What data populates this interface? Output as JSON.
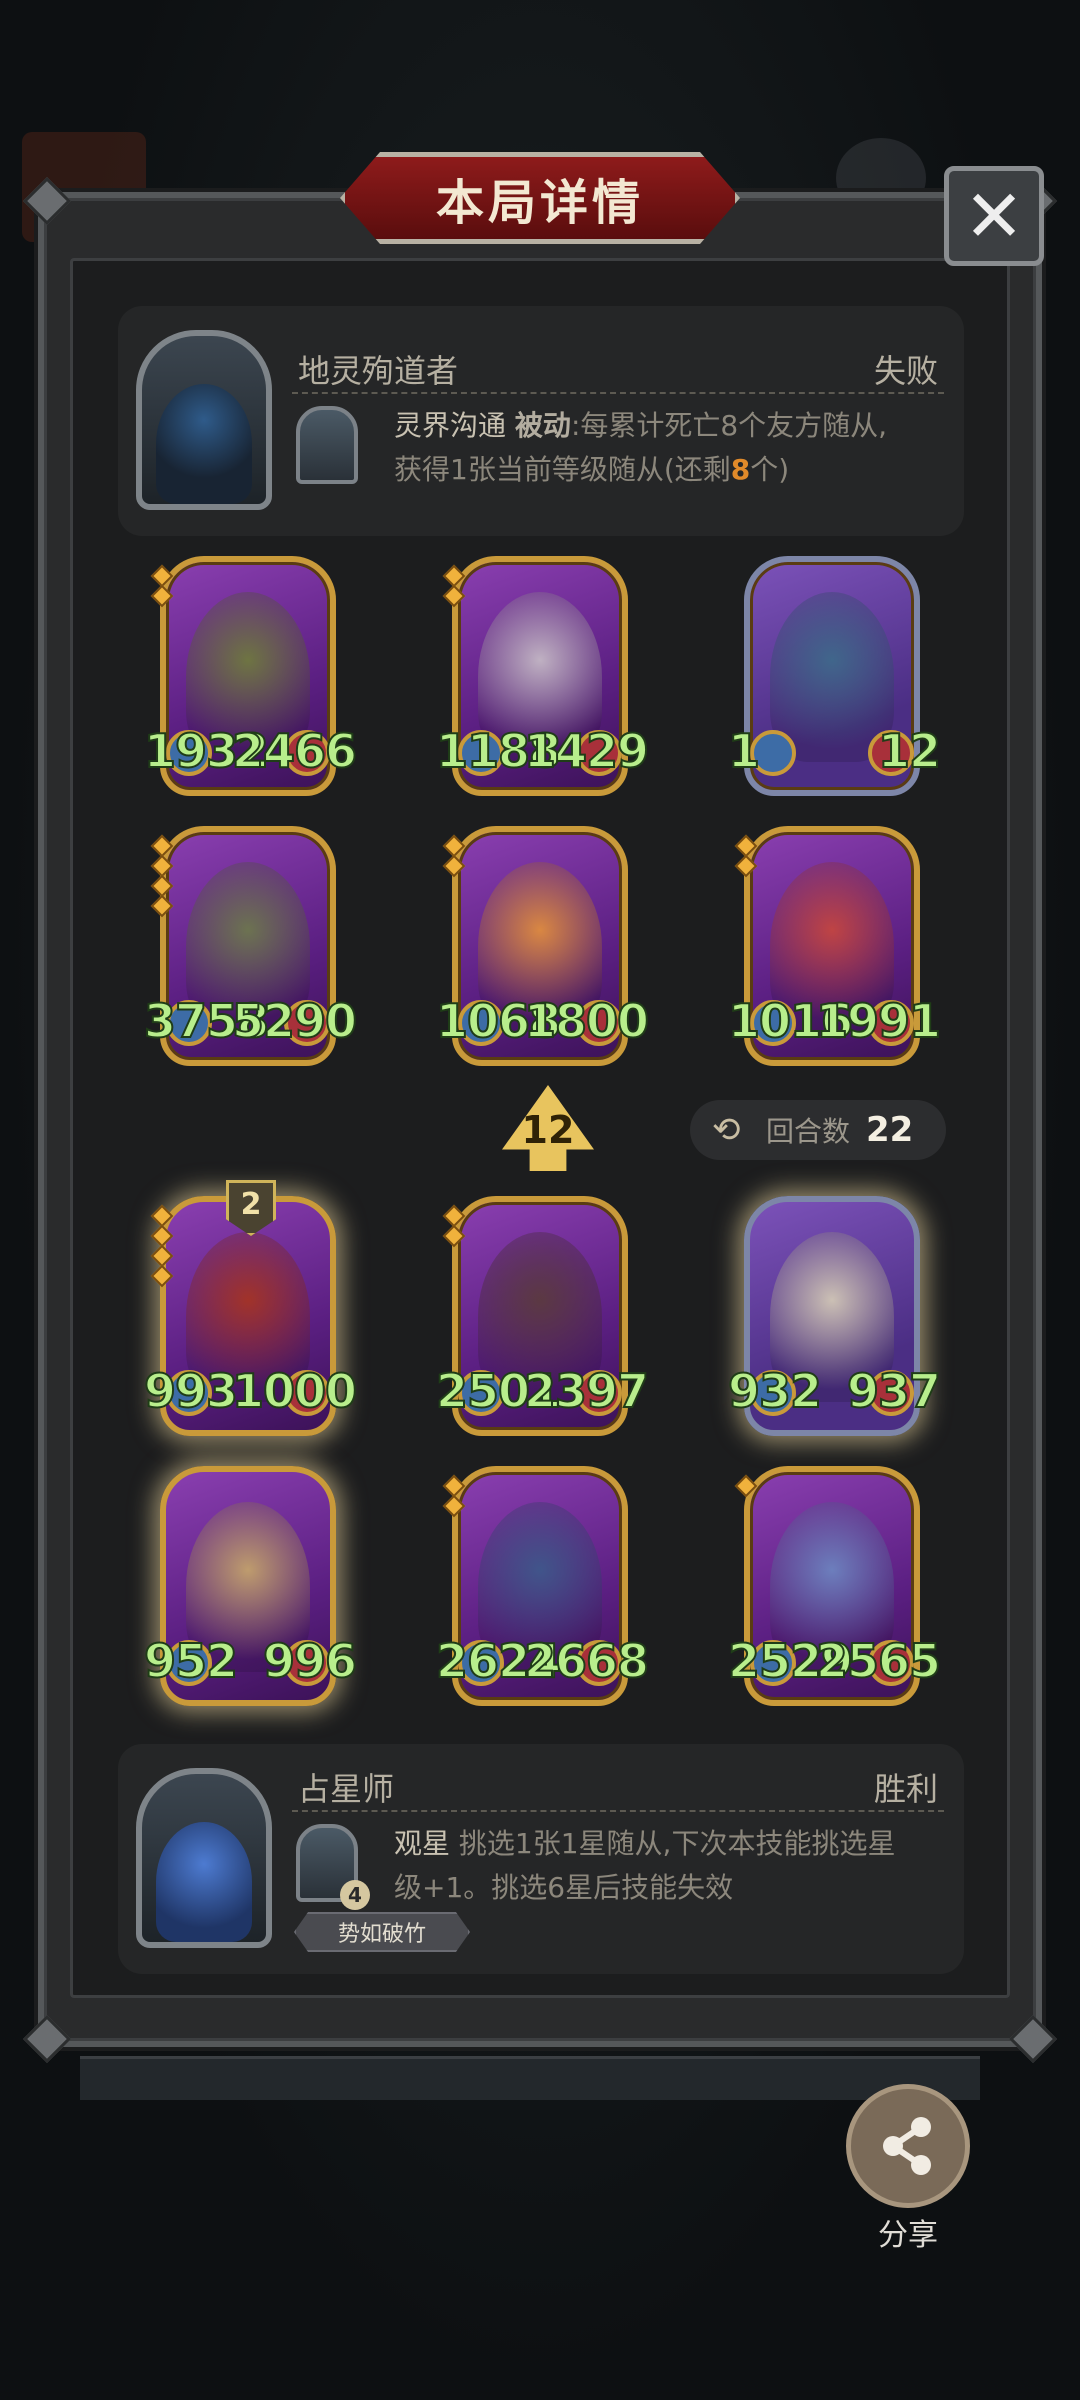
{
  "header": {
    "title": "本局详情",
    "close_icon": "close-icon"
  },
  "opponent": {
    "hero_name": "地灵殉道者",
    "result": "失败",
    "skill_name": "灵界沟通",
    "skill_type": "被动",
    "skill_desc_1": ":每累计死亡8个友方随从,",
    "skill_desc_2": "获得1张当前等级随从(还剩",
    "skill_remaining": "8",
    "skill_desc_3": "个)"
  },
  "opponent_board": [
    {
      "atk": "1932",
      "hp": "2466",
      "stars": 2
    },
    {
      "atk": "1188",
      "hp": "1429",
      "stars": 2
    },
    {
      "atk": "1",
      "hp": "12",
      "stars": 0
    },
    {
      "atk": "3758",
      "hp": "5290",
      "stars": 4
    },
    {
      "atk": "1068",
      "hp": "1800",
      "stars": 2
    },
    {
      "atk": "1016",
      "hp": "1991",
      "stars": 2
    }
  ],
  "status": {
    "tier": "12",
    "round_label": "回合数",
    "round_value": "22"
  },
  "player_board": [
    {
      "atk": "993",
      "hp": "1000",
      "stars": 4,
      "badge": "2"
    },
    {
      "atk": "2501",
      "hp": "2397",
      "stars": 2
    },
    {
      "atk": "932",
      "hp": "937",
      "stars": 0
    },
    {
      "atk": "952",
      "hp": "996",
      "stars": 0
    },
    {
      "atk": "2624",
      "hp": "2668",
      "stars": 2
    },
    {
      "atk": "2529",
      "hp": "2565",
      "stars": 1
    }
  ],
  "player": {
    "hero_name": "占星师",
    "result": "胜利",
    "skill_name": "观星",
    "skill_desc_1": "挑选1张1星随从,下次本技能挑选星",
    "skill_desc_2": "级+1。挑选6星后技能失效",
    "skill_level": "4",
    "tag": "势如破竹"
  },
  "share": {
    "label": "分享",
    "icon": "share-icon"
  },
  "colors": {
    "stat_green": "#b8ee8c",
    "gold": "#c99a3a",
    "title_red": "#8e1b1b"
  }
}
